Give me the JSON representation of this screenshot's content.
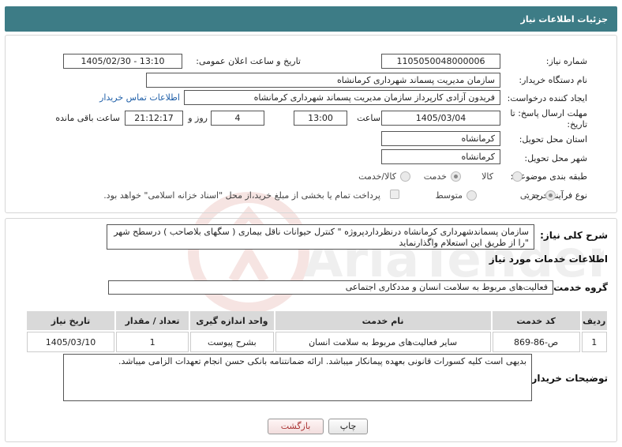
{
  "header": {
    "title": "جزئیات اطلاعات نیاز"
  },
  "form": {
    "need_number": {
      "label": "شماره نیاز:",
      "value": "1105050048000006"
    },
    "announce_datetime": {
      "label": "تاریخ و ساعت اعلان عمومی:",
      "value": "1405/02/30 - 13:10"
    },
    "buyer_org": {
      "label": "نام دستگاه خریدار:",
      "value": "سازمان مدیریت پسماند شهرداری کرمانشاه"
    },
    "requester": {
      "label": "ایجاد کننده درخواست:",
      "value": "فریدون آزادی کارپرداز سازمان مدیریت پسماند شهرداری کرمانشاه",
      "contact_link": "اطلاعات تماس خریدار"
    },
    "deadline": {
      "label_line1": "مهلت ارسال پاسخ: تا",
      "label_line2": "تاریخ:",
      "date": "1405/03/04",
      "time_label": "ساعت",
      "time": "13:00",
      "days": "4",
      "days_label": "روز و",
      "remaining": "21:12:17",
      "remaining_label": "ساعت باقی مانده"
    },
    "province": {
      "label": "استان محل تحویل:",
      "value": "کرمانشاه"
    },
    "city": {
      "label": "شهر محل تحویل:",
      "value": "کرمانشاه"
    },
    "category": {
      "label": "طبقه بندی موضوعی:",
      "options": [
        "کالا",
        "خدمت",
        "کالا/خدمت"
      ],
      "selected": "خدمت"
    },
    "process_type": {
      "label": "نوع فرآیند خرید :",
      "options": [
        "جزیی",
        "متوسط"
      ],
      "selected": "جزیی",
      "payment_note": "پرداخت تمام یا بخشی از مبلغ خرید،از محل \"اسناد خزانه اسلامی\" خواهد بود."
    }
  },
  "summary": {
    "label": "شرح کلی نیاز:",
    "text": "سازمان پسماندشهرداری کرمانشاه درنظرداردپروژه \" کنترل حیوانات ناقل بیماری ( سگهای بلاصاحب ) درسطح شهر \"را از طریق این استعلام واگذارنماید"
  },
  "services": {
    "section_title": "اطلاعات خدمات مورد نیاز",
    "group_label": "گروه خدمت:",
    "group_value": "فعالیت‌های مربوط به سلامت انسان و مددکاری اجتماعی",
    "columns": [
      "ردیف",
      "کد خدمت",
      "نام خدمت",
      "واحد اندازه گیری",
      "تعداد / مقدار",
      "تاریخ نیاز"
    ],
    "rows": [
      [
        "1",
        "ص-86-869",
        "سایر فعالیت‌های مربوط به سلامت انسان",
        "بشرح پیوست",
        "1",
        "1405/03/10"
      ]
    ]
  },
  "buyer_notes": {
    "label": "توضیحات خریدار:",
    "text": "بدیهی است کلیه کسورات قانونی بعهده پیمانکار میباشد. ارائه ضمانتنامه بانکی حسن انجام تعهدات الزامی میباشد."
  },
  "buttons": {
    "print": "چاپ",
    "back": "بازگشت"
  },
  "watermark": {
    "text": "AriaTender.neT"
  },
  "colors": {
    "header_bg": "#3d7c86",
    "link": "#1f5fa8",
    "back_button": "#a33333"
  }
}
